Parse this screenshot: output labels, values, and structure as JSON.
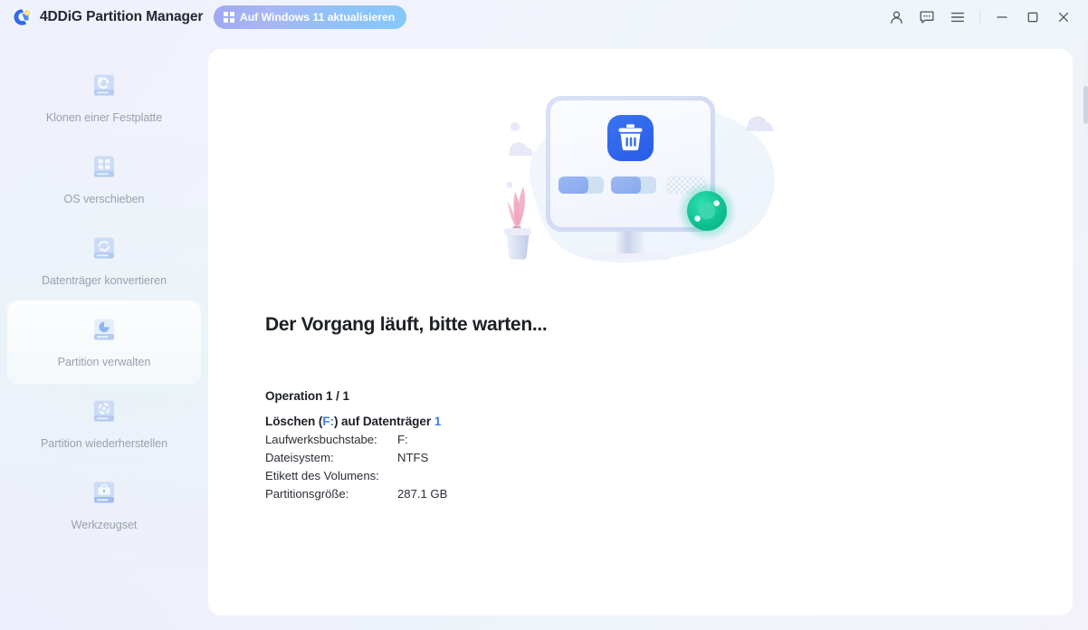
{
  "window": {
    "app_title": "4DDiG Partition Manager",
    "logo_icon": "4ddig-logo-icon",
    "upgrade_button": {
      "label": "Auf Windows 11 aktualisieren",
      "icon": "windows-logo-icon"
    },
    "controls": [
      {
        "name": "account-icon",
        "label": "Konto"
      },
      {
        "name": "feedback-icon",
        "label": "Feedback"
      },
      {
        "name": "menu-icon",
        "label": "Menü"
      },
      {
        "name": "minimize-button",
        "label": "Minimieren"
      },
      {
        "name": "maximize-button",
        "label": "Maximieren"
      },
      {
        "name": "close-button",
        "label": "Schließen"
      }
    ]
  },
  "sidebar": {
    "items": [
      {
        "label": "Klonen einer Festplatte",
        "icon": "clone-disk-icon",
        "active": false
      },
      {
        "label": "OS verschieben",
        "icon": "migrate-os-icon",
        "active": false
      },
      {
        "label": "Datenträger konvertieren",
        "icon": "convert-disk-icon",
        "active": false
      },
      {
        "label": "Partition verwalten",
        "icon": "manage-partition-icon",
        "active": true
      },
      {
        "label": "Partition wiederherstellen",
        "icon": "recover-partition-icon",
        "active": false
      },
      {
        "label": "Werkzeugset",
        "icon": "toolkit-icon",
        "active": false
      }
    ]
  },
  "main": {
    "illustration": {
      "name": "deleting-partition-illustration",
      "monitor_icon": "monitor-icon",
      "badge_icon": "trash-bin-icon",
      "spinner_icon": "green-loading-spinner-icon",
      "plant_icon": "potted-plant-icon",
      "cloud_icon": "cloud-icon",
      "bars": [
        "partition-bar-1",
        "partition-bar-2",
        "partition-bar-unallocated"
      ]
    },
    "headline": "Der Vorgang läuft, bitte warten...",
    "operation_counter": "Operation 1 / 1",
    "operation_title": {
      "prefix": "Löschen (",
      "drive": "F:",
      "middle": ") auf Datenträger ",
      "disk": "1"
    },
    "details": [
      {
        "label": "Laufwerksbuchstabe:",
        "value": "F:"
      },
      {
        "label": "Dateisystem:",
        "value": "NTFS"
      },
      {
        "label": "Etikett des Volumens:",
        "value": ""
      },
      {
        "label": "Partitionsgröße:",
        "value": "287.1 GB"
      }
    ]
  },
  "colors": {
    "accent_blue": "#3f7cf5",
    "spinner_green": "#16c79a",
    "text_dark": "#1d2026",
    "text_muted": "#9aa1ae",
    "panel_white": "#ffffff"
  }
}
